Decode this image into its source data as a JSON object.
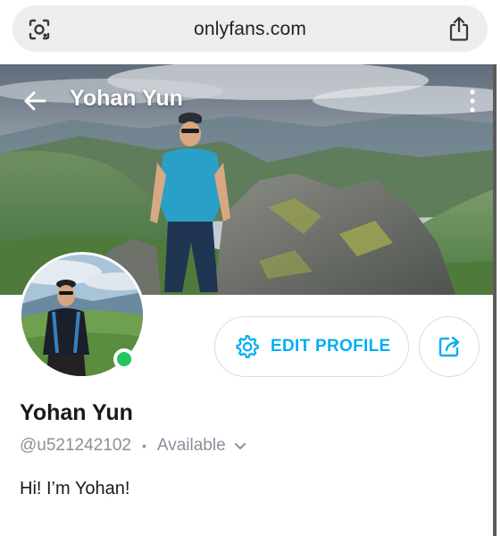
{
  "browser": {
    "url": "onlyfans.com",
    "left_icon": "lens-icon",
    "right_icon": "share-icon"
  },
  "header": {
    "title": "Yohan Yun",
    "back_icon": "back-arrow-icon",
    "menu_icon": "more-vertical-icon"
  },
  "profile": {
    "display_name": "Yohan Yun",
    "username": "@u521242102",
    "separator": "•",
    "status": "Available",
    "online": true,
    "bio": "Hi! I’m Yohan!"
  },
  "actions": {
    "edit_profile_label": "EDIT PROFILE",
    "edit_icon": "gear-icon",
    "share_icon": "share-arrow-icon"
  },
  "colors": {
    "accent": "#00aff0",
    "online": "#22c55e",
    "muted": "#8a9099",
    "text": "#1a1a1a",
    "url_pill": "#ecedef"
  }
}
